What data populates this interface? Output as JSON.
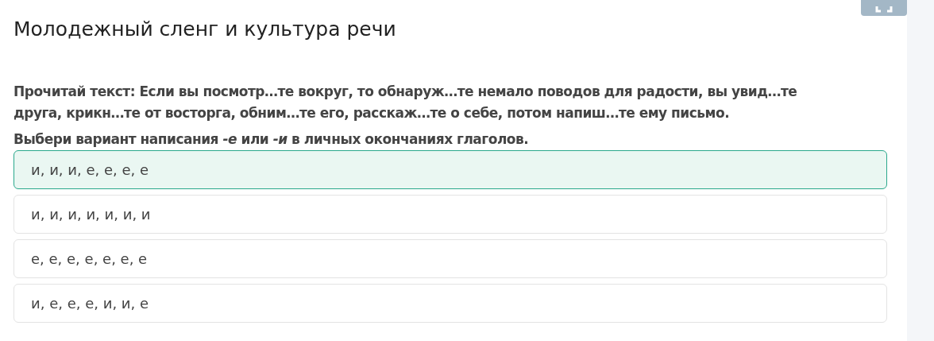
{
  "title": "Молодежный сленг и культура речи",
  "question": "Прочитай текст: Если вы посмотр…те вокруг, то обнаруж…те немало поводов для радости, вы увид…те друга, крикн…те от восторга, обним…те его, расскаж…те о себе, потом напиш…те ему письмо.",
  "instruction": "Выбери вариант написания *-е* или *-и* в личных окончаниях глаголов.",
  "options": [
    {
      "label": "и, и, и, е, е, е, е",
      "selected": true
    },
    {
      "label": "и, и, и, и, и, и, и",
      "selected": false
    },
    {
      "label": "е, е, е, е, е, е, е",
      "selected": false
    },
    {
      "label": "и, е, е, е, и, и, е",
      "selected": false
    }
  ]
}
